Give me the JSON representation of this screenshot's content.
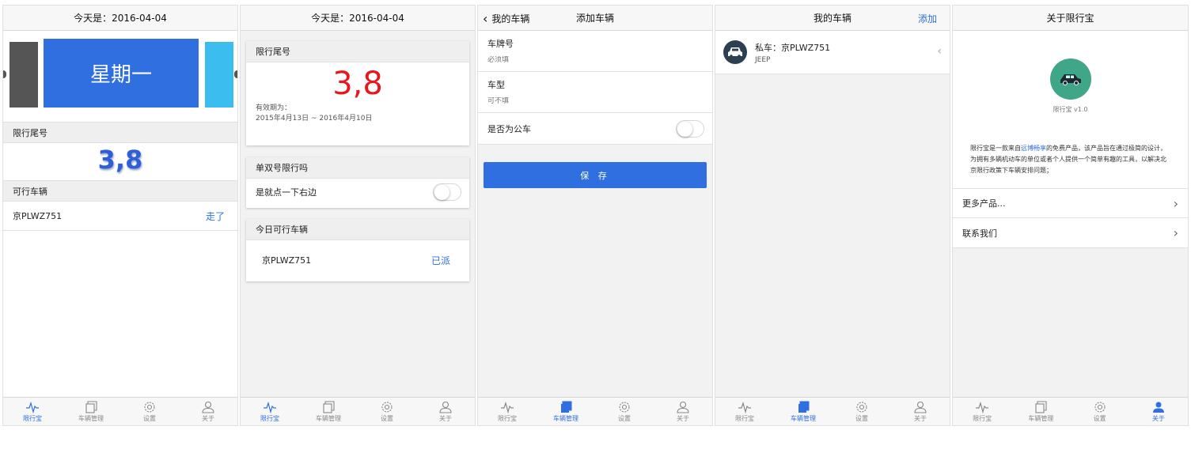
{
  "colors": {
    "accent": "#2f6fe0",
    "red": "#e8161d",
    "green_logo": "#3fa687"
  },
  "tabs": [
    "限行宝",
    "车辆管理",
    "设置",
    "关于"
  ],
  "tab_icons": [
    "pulse-icon",
    "car-manage-icon",
    "gear-icon",
    "user-icon"
  ],
  "screen1": {
    "title": "今天是：2016-04-04",
    "weekday": "星期一",
    "limit_header": "限行尾号",
    "limit_numbers": "3,8",
    "vehicles_header": "可行车辆",
    "vehicle_plate": "京PLWZ751",
    "vehicle_action": "走了"
  },
  "screen2": {
    "title": "今天是：2016-04-04",
    "limit_header": "限行尾号",
    "limit_numbers": "3,8",
    "valid_label": "有效期为：",
    "valid_range": "2015年4月13日 ~ 2016年4月10日",
    "oddeven_header": "单双号限行吗",
    "oddeven_row": "是就点一下右边",
    "oddeven_on": false,
    "today_header": "今日可行车辆",
    "vehicle_plate": "京PLWZ751",
    "vehicle_status": "已派"
  },
  "screen3": {
    "back_label": "我的车辆",
    "title": "添加车辆",
    "plate_label": "车牌号",
    "plate_placeholder": "必须填",
    "model_label": "车型",
    "model_placeholder": "可不填",
    "public_label": "是否为公车",
    "public_on": false,
    "save_label": "保 存"
  },
  "screen4": {
    "title": "我的车辆",
    "add_label": "添加",
    "car_name": "私车：京PLWZ751",
    "car_model": "JEEP"
  },
  "screen5": {
    "title": "关于限行宝",
    "version": "限行宝 v1.0",
    "desc_pre": "限行宝是一款来自",
    "desc_link": "远博畅享",
    "desc_post": "的免费产品，该产品旨在通过极简的设计，为拥有多辆机动车的单位或者个人提供一个简单有趣的工具，以解决北京限行政策下车辆安排问题；",
    "menu": [
      "更多产品...",
      "联系我们"
    ]
  },
  "active_tabs": [
    0,
    0,
    1,
    1,
    3
  ]
}
